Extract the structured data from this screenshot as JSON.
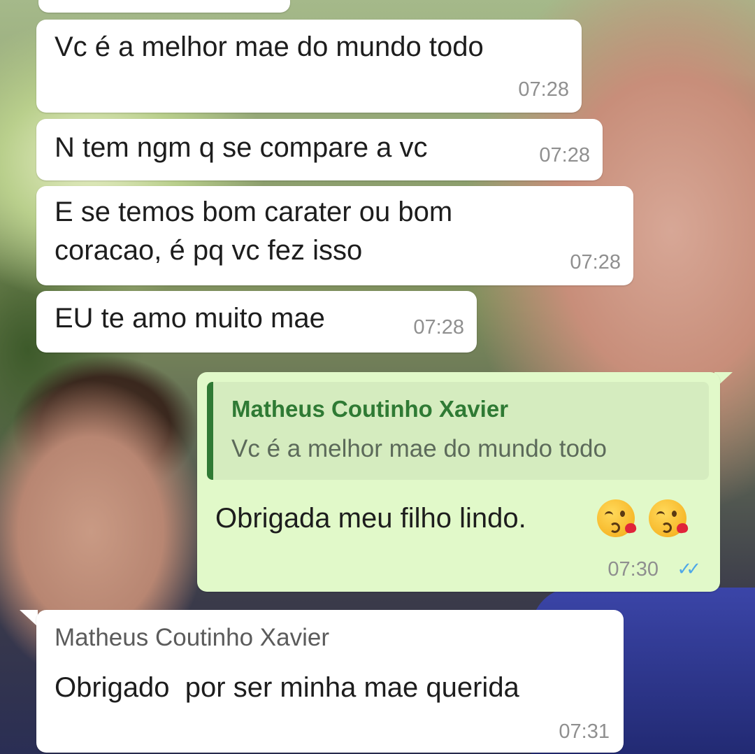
{
  "messages": [
    {
      "text": "Vc é a melhor mae do mundo todo",
      "time": "07:28"
    },
    {
      "text": "N tem ngm q se compare a vc",
      "time": "07:28"
    },
    {
      "text": "E se temos bom carater ou bom\ncoracao, é pq vc fez isso",
      "time": "07:28"
    },
    {
      "text": "EU te amo muito mae",
      "time": "07:28"
    }
  ],
  "reply": {
    "quoted_sender": "Matheus Coutinho Xavier",
    "quoted_text": "Vc é a melhor mae do mundo todo",
    "text": "Obrigada meu filho lindo.",
    "emojis": [
      "kissing-face-icon",
      "kissing-face-icon"
    ],
    "time": "07:30",
    "status": "read"
  },
  "last_message": {
    "sender": "Matheus Coutinho Xavier",
    "text": "Obrigado  por ser minha mae querida",
    "time": "07:31"
  },
  "colors": {
    "incoming_bubble": "#ffffff",
    "outgoing_bubble": "#e1f9c9",
    "quote_accent": "#2f7a34",
    "read_ticks": "#4fa8e8"
  }
}
